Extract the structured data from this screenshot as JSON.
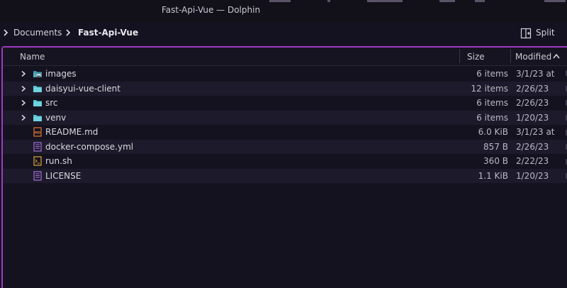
{
  "window": {
    "title": "Fast-Api-Vue — Dolphin"
  },
  "toolbar": {
    "breadcrumb": [
      "Documents",
      "Fast-Api-Vue"
    ],
    "split_label": "Split"
  },
  "columns": {
    "name": "Name",
    "size": "Size",
    "modified": "Modified",
    "sort_direction": "ascending"
  },
  "files": [
    {
      "name": "images",
      "size": "6 items",
      "modified": "3/1/23 at",
      "kind": "folder-image",
      "expandable": true
    },
    {
      "name": "daisyui-vue-client",
      "size": "12 items",
      "modified": "2/26/23",
      "kind": "folder",
      "expandable": true
    },
    {
      "name": "src",
      "size": "6 items",
      "modified": "2/26/23",
      "kind": "folder",
      "expandable": true
    },
    {
      "name": "venv",
      "size": "6 items",
      "modified": "1/20/23",
      "kind": "folder",
      "expandable": true
    },
    {
      "name": "README.md",
      "size": "6.0 KiB",
      "modified": "3/1/23 at",
      "kind": "markdown",
      "expandable": false
    },
    {
      "name": "docker-compose.yml",
      "size": "857 B",
      "modified": "2/26/23",
      "kind": "text",
      "expandable": false
    },
    {
      "name": "run.sh",
      "size": "360 B",
      "modified": "2/22/23",
      "kind": "script",
      "expandable": false
    },
    {
      "name": "LICENSE",
      "size": "1.1 KiB",
      "modified": "1/20/23",
      "kind": "text",
      "expandable": false
    }
  ],
  "colors": {
    "accent": "#a139c4",
    "folder": "#52c3d1",
    "markdown": "#e07a35",
    "text_file": "#a270d6",
    "script": "#d9a93a"
  }
}
